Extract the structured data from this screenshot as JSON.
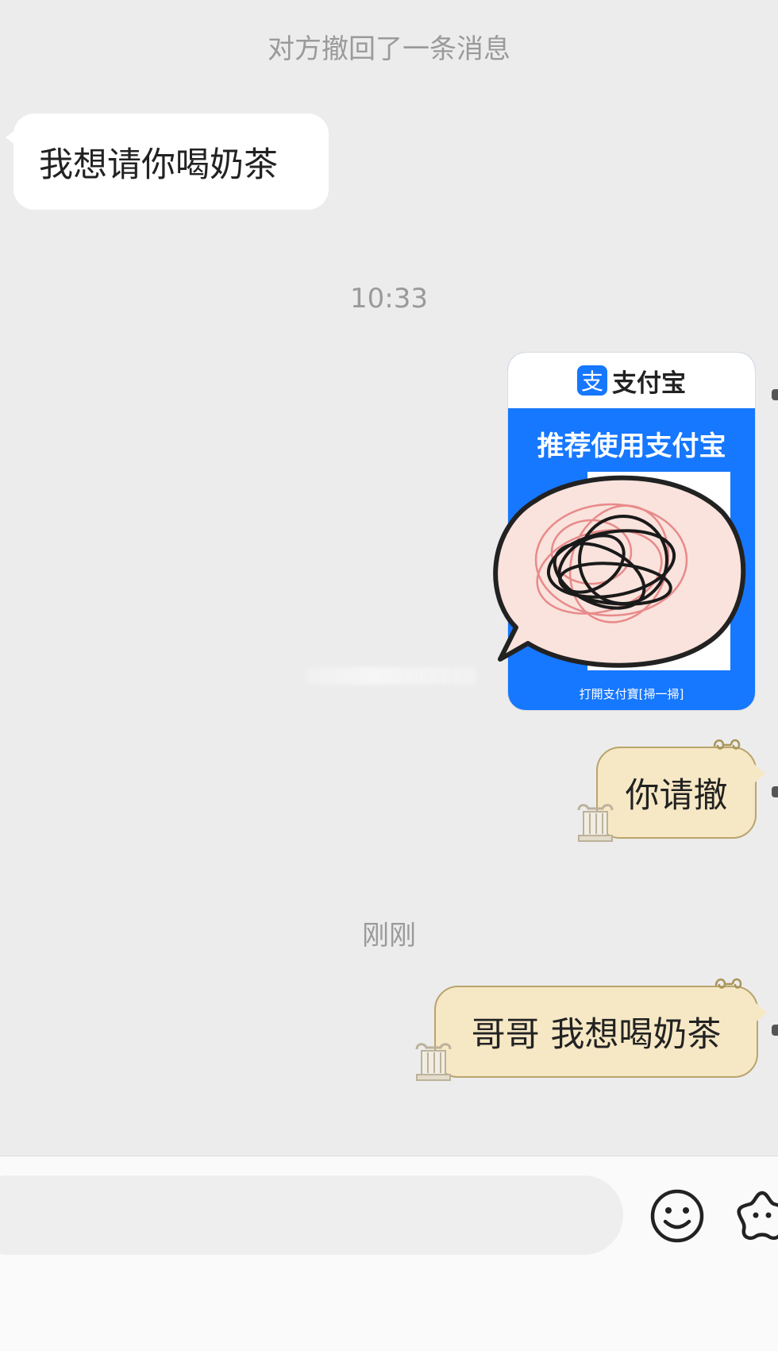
{
  "system": {
    "recall_notice": "对方撤回了一条消息",
    "time_1": "10:33",
    "time_2": "刚刚"
  },
  "messages": {
    "incoming_1": "我想请你喝奶茶",
    "image_card": {
      "brand": "支付宝",
      "logo_char": "支",
      "headline": "推荐使用支付宝",
      "footer": "打開支付寶[掃一掃]"
    },
    "outgoing_1": "你请撤",
    "outgoing_2": "哥哥 我想喝奶茶"
  },
  "icons": [
    "emoji-icon",
    "more-icon",
    "scroll-decoration-icon",
    "column-decoration-icon"
  ],
  "colors": {
    "background": "#ececec",
    "incoming_bubble": "#ffffff",
    "outgoing_bubble": "#f6e8c5",
    "alipay_blue": "#1677ff"
  }
}
